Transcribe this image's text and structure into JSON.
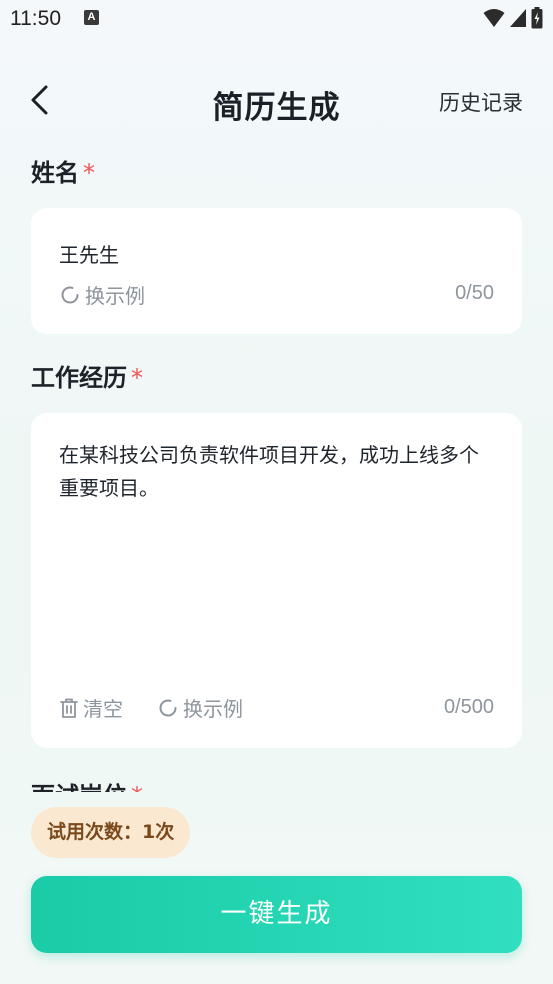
{
  "status_bar": {
    "time": "11:50",
    "notification_glyph": "A"
  },
  "nav": {
    "title": "简历生成",
    "history_label": "历史记录"
  },
  "name_field": {
    "label": "姓名",
    "required_mark": "*",
    "value": "王先生",
    "example_label": "换示例",
    "counter": "0/50"
  },
  "experience_field": {
    "label": "工作经历",
    "required_mark": "*",
    "value": "在某科技公司负责软件项目开发，成功上线多个重要项目。",
    "clear_label": "清空",
    "example_label": "换示例",
    "counter": "0/500"
  },
  "position_field": {
    "label": "面试岗位",
    "required_mark": "*"
  },
  "trial": {
    "text": "试用次数：1次"
  },
  "generate_button": {
    "label": "一键生成"
  },
  "colors": {
    "accent": "#19cba7",
    "required": "#f05454",
    "badge_bg": "#fbe8d0",
    "badge_text": "#7a4a1d"
  }
}
